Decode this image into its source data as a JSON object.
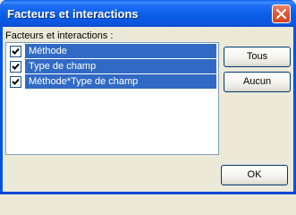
{
  "window": {
    "title": "Facteurs et interactions"
  },
  "list": {
    "label": "Facteurs et interactions :",
    "items": [
      {
        "label": "Méthode",
        "checked": true,
        "selected": true
      },
      {
        "label": "Type de champ",
        "checked": true,
        "selected": true
      },
      {
        "label": "Méthode*Type de champ",
        "checked": true,
        "selected": true
      }
    ]
  },
  "buttons": {
    "all_label": "Tous",
    "none_label": "Aucun",
    "ok_label": "OK"
  },
  "colors": {
    "titlebar": "#0a5ee8",
    "selection": "#316ac5",
    "dialog_bg": "#ece9d8",
    "close_button": "#e15d3b"
  },
  "icons": {
    "close": "close-icon",
    "checkbox": "checkmark-icon"
  }
}
